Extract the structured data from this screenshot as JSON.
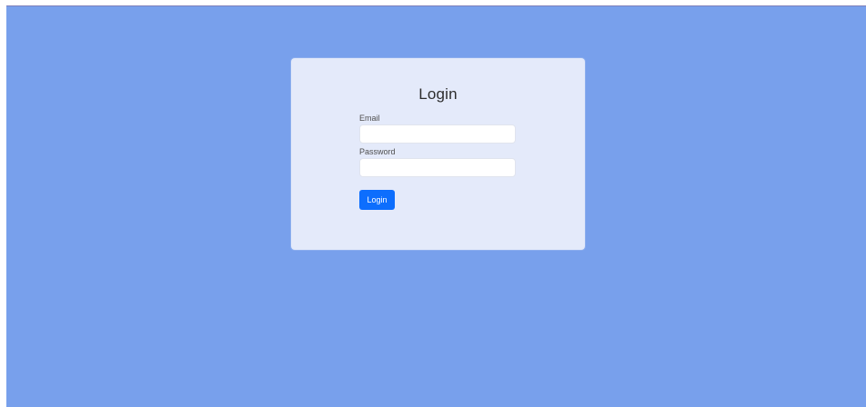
{
  "login_form": {
    "title": "Login",
    "email_label": "Email",
    "email_value": "",
    "password_label": "Password",
    "password_value": "",
    "submit_label": "Login"
  },
  "colors": {
    "background": "#78a0ec",
    "card": "#e4eafa",
    "button": "#0d6efd"
  }
}
